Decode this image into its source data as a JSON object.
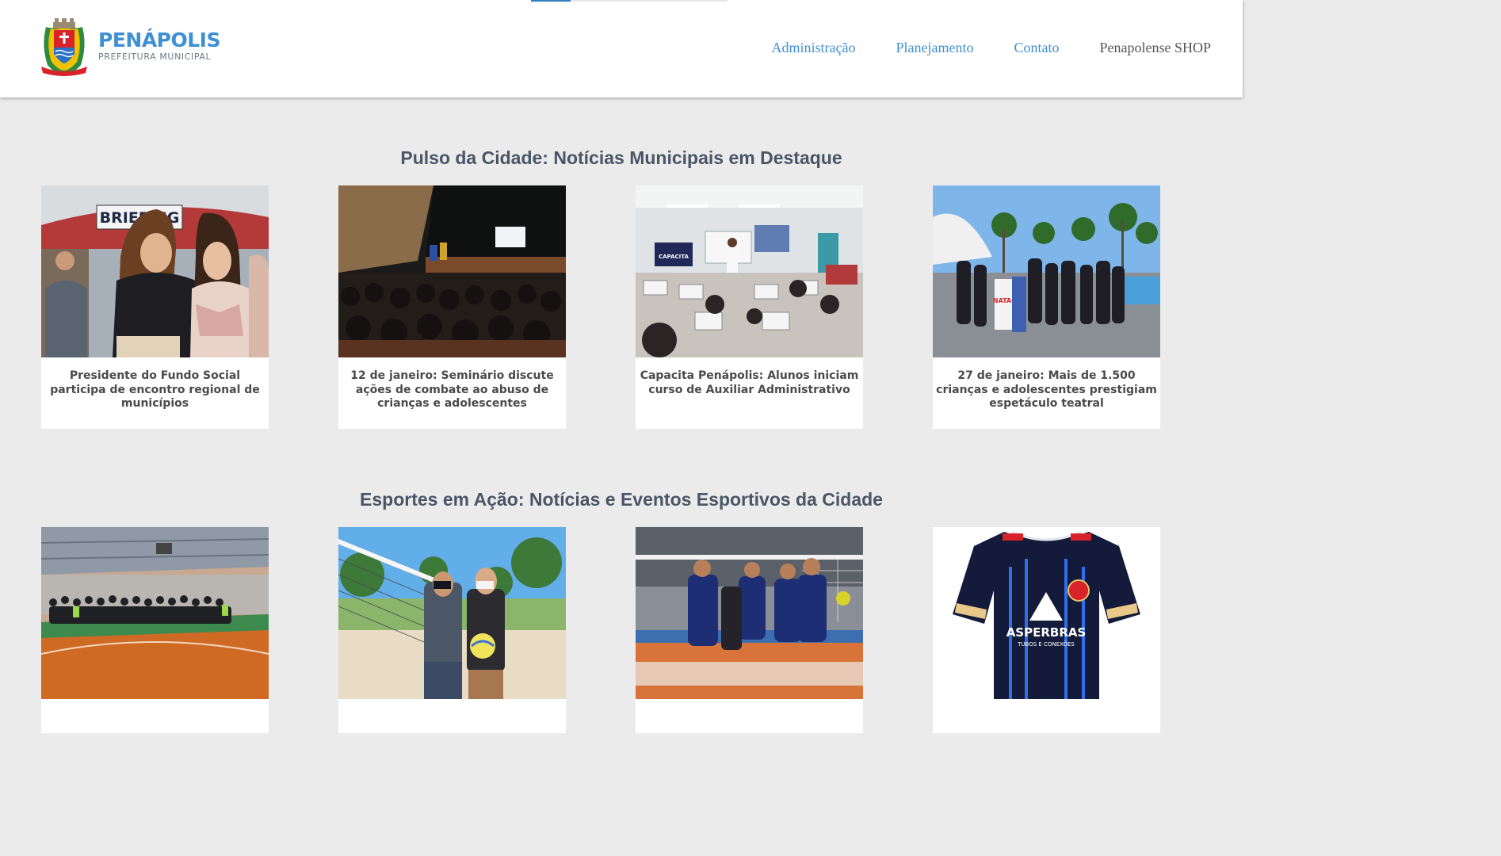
{
  "header": {
    "logo": {
      "name": "PENÁPOLIS",
      "subtitle": "PREFEITURA MUNICIPAL"
    },
    "nav": [
      {
        "label": "Administração"
      },
      {
        "label": "Planejamento"
      },
      {
        "label": "Contato"
      },
      {
        "label": "Penapolense SHOP"
      }
    ]
  },
  "sections": [
    {
      "title": "Pulso da Cidade: Notícias Municipais em Destaque",
      "cards": [
        {
          "title": "Presidente do Fundo Social participa de encontro regional de municípios",
          "image_text": "BRIEFING"
        },
        {
          "title": "12 de janeiro: Seminário discute ações de combate ao abuso de crianças e adolescentes"
        },
        {
          "title": "Capacita Penápolis: Alunos iniciam curso de Auxiliar Administrativo",
          "image_text": "CAPACITA"
        },
        {
          "title": "27 de janeiro: Mais de 1.500 crianças e adolescentes prestigiam espetáculo teatral",
          "image_text": "NATAÇÃO"
        }
      ]
    },
    {
      "title": "Esportes em Ação: Notícias e Eventos Esportivos da Cidade",
      "cards": [
        {},
        {},
        {},
        {
          "image_text": "ASPERBRAS",
          "image_subtext": "TUBOS E CONEXÕES"
        }
      ]
    }
  ]
}
